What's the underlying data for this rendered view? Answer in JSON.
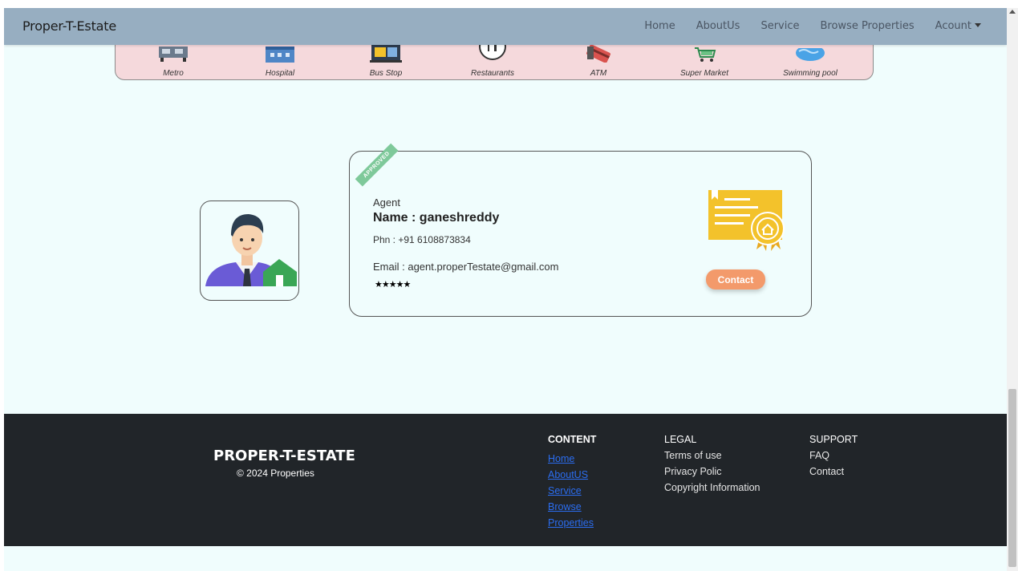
{
  "navbar": {
    "brand": "Proper-T-Estate",
    "links": [
      "Home",
      "AboutUs",
      "Service",
      "Browse Properties",
      "Acount"
    ]
  },
  "amenities": [
    "Metro",
    "Hospital",
    "Bus Stop",
    "Restaurants",
    "ATM",
    "Super Market",
    "Swimming pool"
  ],
  "agent": {
    "badge": "APPROVED",
    "label": "Agent",
    "name": "Name : ganeshreddy",
    "phone": "Phn : +91 6108873834",
    "email": "Email : agent.properTestate@gmail.com",
    "stars": "★★★★★",
    "contact_label": "Contact"
  },
  "footer": {
    "brand": "PROPER-T-ESTATE",
    "copyright": "© 2024 Properties",
    "content": {
      "heading": "CONTENT",
      "links": [
        "Home",
        "AboutUS",
        "Service",
        "Browse",
        "Properties"
      ]
    },
    "legal": {
      "heading": "LEGAL",
      "items": [
        "Terms of use",
        "Privacy Polic",
        "Copyright Information"
      ]
    },
    "support": {
      "heading": "SUPPORT",
      "items": [
        "FAQ",
        "Contact"
      ]
    }
  },
  "colors": {
    "navbar": "#97aec1",
    "page_bg": "#f0fdfd",
    "amenity_strip": "#f5d9dc",
    "footer_bg": "#212529",
    "contact_button": "#f39a6b",
    "link": "#2b6df0",
    "badge": "#7ec99a",
    "certificate": "#f3c22b"
  }
}
